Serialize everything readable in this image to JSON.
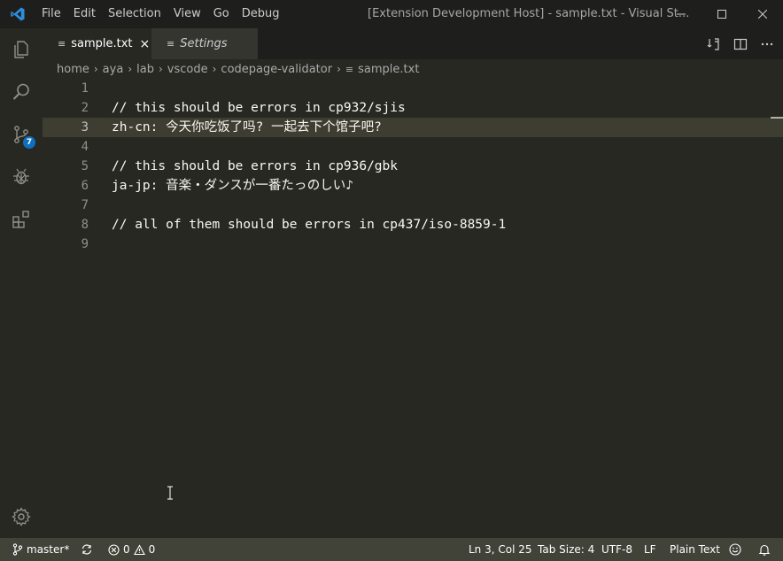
{
  "titlebar": {
    "menu": [
      "File",
      "Edit",
      "Selection",
      "View",
      "Go",
      "Debug"
    ],
    "window_title": "[Extension Development Host] - sample.txt - Visual St..."
  },
  "activitybar": {
    "items": [
      "explorer-icon",
      "search-icon",
      "source-control-icon",
      "debug-icon",
      "extensions-icon"
    ],
    "scm_badge": "7",
    "settings": "gear-icon"
  },
  "tabs": [
    {
      "label": "sample.txt",
      "active": true
    },
    {
      "label": "Settings",
      "active": false
    }
  ],
  "breadcrumb": {
    "parts": [
      "home",
      "aya",
      "lab",
      "vscode",
      "codepage-validator"
    ],
    "file": "sample.txt"
  },
  "editor": {
    "current_line": 3,
    "lines": [
      {
        "num": "1",
        "text": ""
      },
      {
        "num": "2",
        "text": "// this should be errors in cp932/sjis"
      },
      {
        "num": "3",
        "text": "zh-cn: 今天你吃饭了吗? 一起去下个馆子吧?"
      },
      {
        "num": "4",
        "text": ""
      },
      {
        "num": "5",
        "text": "// this should be errors in cp936/gbk"
      },
      {
        "num": "6",
        "text": "ja-jp: 音楽・ダンスが一番たっのしい♪"
      },
      {
        "num": "7",
        "text": ""
      },
      {
        "num": "8",
        "text": "// all of them should be errors in cp437/iso-8859-1"
      },
      {
        "num": "9",
        "text": ""
      }
    ]
  },
  "statusbar": {
    "branch": "master*",
    "errors": "0",
    "warnings": "0",
    "position": "Ln 3, Col 25",
    "tab_size": "Tab Size: 4",
    "encoding": "UTF-8",
    "eol": "LF",
    "language": "Plain Text"
  },
  "colors": {
    "background": "#272822",
    "titlebar": "#1e1f1c",
    "statusbar": "#414339",
    "current_line": "#3e3d32",
    "badge": "#0e70c0",
    "vscode_blue": "#2d8fdc"
  }
}
